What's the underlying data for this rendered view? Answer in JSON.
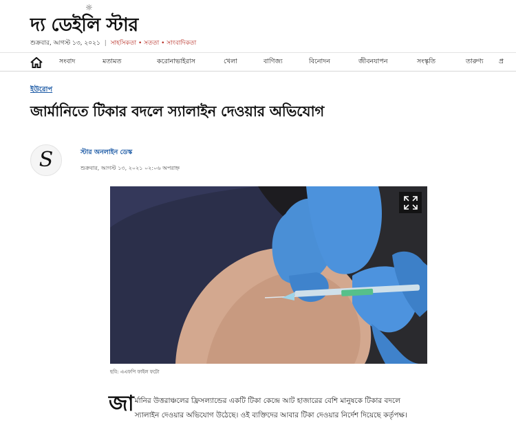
{
  "site": {
    "logo_text": "দ্য ডেইলি স্টার",
    "date_text": "শুক্রবার, আগস্ট ১৩, ২০২১",
    "motto_1": "সাহসিকতা",
    "motto_2": "সততা",
    "motto_3": "সাংবাদিকতা",
    "motto_bullet": "•",
    "separator": "|",
    "brand_color": "#b5281f",
    "link_color": "#1c5aa5"
  },
  "nav": {
    "home_icon": "home-icon",
    "items": [
      "সংবাদ",
      "মতামত",
      "করোনাভাইরাস",
      "খেলা",
      "বাণিজ্য",
      "বিনোদন",
      "জীবনযাপন",
      "সংস্কৃতি",
      "তারুণ্য",
      "প্র"
    ]
  },
  "article": {
    "kicker": "ইউরোপ",
    "headline": "জার্মানিতে টিকার বদলে স্যালাইন দেওয়ার অভিযোগ",
    "author": "স্টার অনলাইন ডেস্ক",
    "published": "শুক্রবার, আগস্ট ১৩, ২০২১ ০২:০৬ অপরাহ্ন",
    "image_caption": "ছবি: এএফপি ফাইল ফটো",
    "expand_icon": "expand-icon",
    "dropcap": "জা",
    "body": "র্মানির উত্তরাঞ্চলের ফ্রিসল্যান্ডের একটি টিকা কেন্দ্রে আট হাজারের বেশি মানুষকে টিকার বদলে স্যালাইন দেওয়ার অভিযোগ উঠেছে। ওই ব্যক্তিদের আবার টিকা দেওয়ার নির্দেশ দিয়েছে কর্তৃপক্ষ।"
  }
}
